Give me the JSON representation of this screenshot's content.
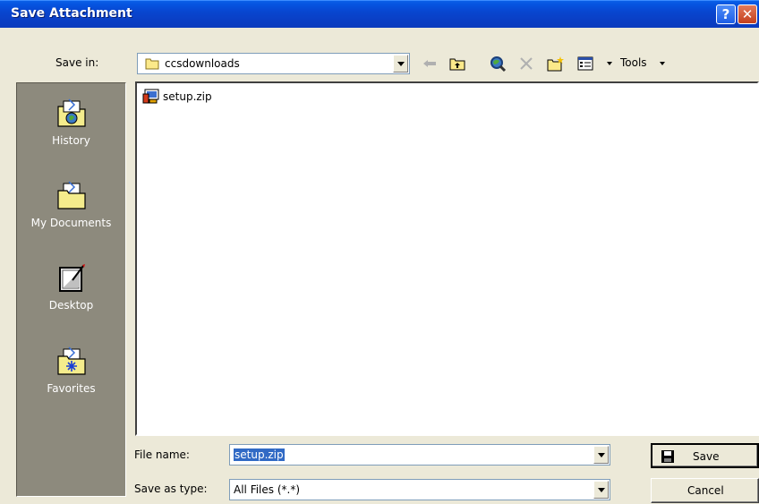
{
  "window": {
    "title": "Save Attachment",
    "help_glyph": "?",
    "close_glyph": "✕"
  },
  "toolbar": {
    "save_in_label": "Save in:",
    "save_in_value": "ccsdownloads",
    "tools_label": "Tools",
    "icons": [
      "back-arrow-icon",
      "up-folder-icon",
      "search-web-icon",
      "delete-icon",
      "new-folder-icon",
      "views-icon"
    ]
  },
  "places": [
    {
      "label": "History",
      "icon": "history-icon"
    },
    {
      "label": "My Documents",
      "icon": "my-documents-icon"
    },
    {
      "label": "Desktop",
      "icon": "desktop-icon"
    },
    {
      "label": "Favorites",
      "icon": "favorites-icon"
    }
  ],
  "files": [
    {
      "name": "setup.zip",
      "icon": "zip-file-icon"
    }
  ],
  "form": {
    "file_name_label": "File name:",
    "file_name_value": "setup.zip",
    "save_type_label": "Save as type:",
    "save_type_value": "All Files (*.*)"
  },
  "buttons": {
    "save": "Save",
    "cancel": "Cancel"
  },
  "colors": {
    "titlebar": "#0846d0",
    "dialog_bg": "#ece9d8",
    "places_bg": "#8d8a7d",
    "selection": "#316ac5"
  }
}
